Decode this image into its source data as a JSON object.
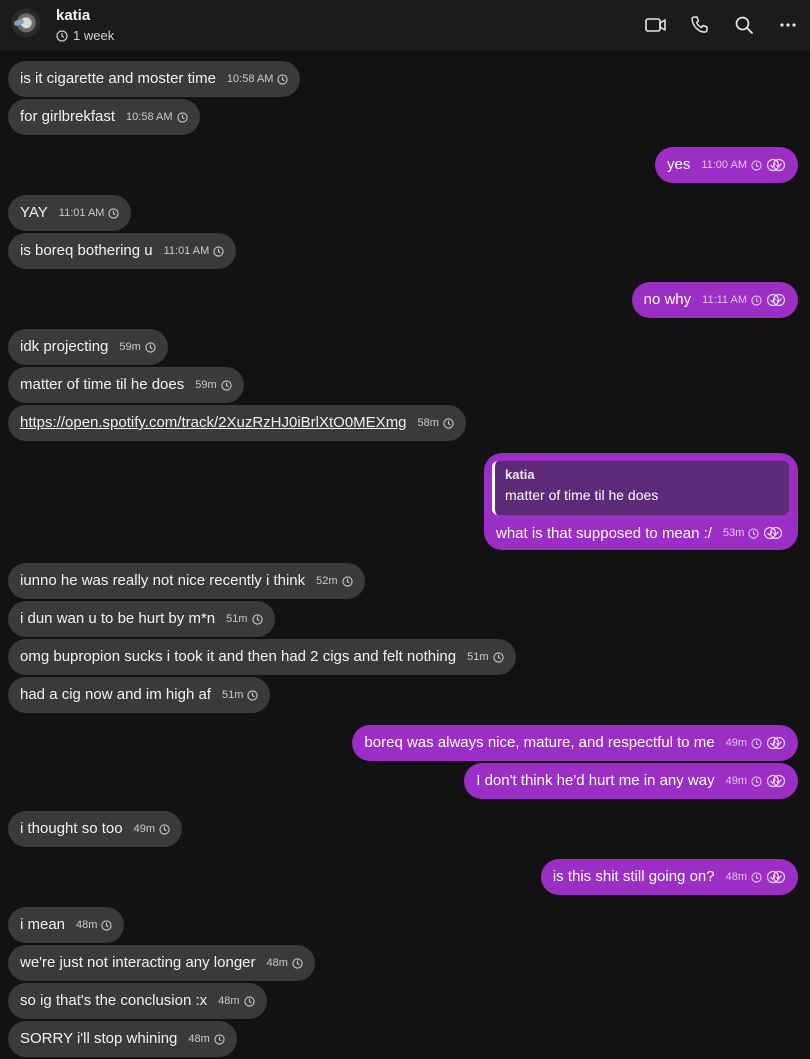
{
  "header": {
    "contact_name": "katia",
    "last_seen": "1 week",
    "icons": [
      "video-call-icon",
      "phone-icon",
      "search-icon",
      "more-icon"
    ]
  },
  "messages": [
    {
      "dir": "in",
      "text": "is it cigarette and moster time",
      "time": "10:58 AM"
    },
    {
      "dir": "in",
      "text": "for girlbrekfast",
      "time": "10:58 AM"
    },
    {
      "dir": "out",
      "text": "yes",
      "time": "11:00 AM"
    },
    {
      "dir": "in",
      "text": "YAY",
      "time": "11:01 AM"
    },
    {
      "dir": "in",
      "text": "is boreq bothering u",
      "time": "11:01 AM"
    },
    {
      "dir": "out",
      "text": "no why",
      "time": "11:11 AM"
    },
    {
      "dir": "in",
      "text": "idk projecting",
      "time": "59m"
    },
    {
      "dir": "in",
      "text": "matter of time til he does",
      "time": "59m"
    },
    {
      "dir": "in",
      "text": "https://open.spotify.com/track/2XuzRzHJ0iBrlXtO0MEXmg",
      "time": "58m",
      "link": true
    },
    {
      "dir": "out",
      "text": "what is that supposed to mean :/",
      "time": "53m",
      "quote": {
        "author": "katia",
        "text": "matter of time til he does"
      }
    },
    {
      "dir": "in",
      "text": "iunno he was really not nice recently i think",
      "time": "52m"
    },
    {
      "dir": "in",
      "text": "i dun wan u to be hurt by m*n",
      "time": "51m"
    },
    {
      "dir": "in",
      "text": "omg bupropion sucks i took it and then had 2 cigs and felt nothing",
      "time": "51m"
    },
    {
      "dir": "in",
      "text": "had a cig now and im high af",
      "time": "51m"
    },
    {
      "dir": "out",
      "text": "boreq was always nice, mature, and respectful to me",
      "time": "49m"
    },
    {
      "dir": "out",
      "text": "I don't think he'd hurt me in any way",
      "time": "49m"
    },
    {
      "dir": "in",
      "text": "i thought so too",
      "time": "49m"
    },
    {
      "dir": "out",
      "text": "is this shit still going on?",
      "time": "48m"
    },
    {
      "dir": "in",
      "text": "i mean",
      "time": "48m"
    },
    {
      "dir": "in",
      "text": "we're just not interacting any longer",
      "time": "48m"
    },
    {
      "dir": "in",
      "text": "so ig that's the conclusion :x",
      "time": "48m"
    },
    {
      "dir": "in",
      "text": "SORRY i'll stop whining",
      "time": "48m"
    }
  ],
  "colors": {
    "incoming_bubble": "#3a3a3a",
    "outgoing_bubble": "#9a2ec5",
    "background": "#121212"
  }
}
